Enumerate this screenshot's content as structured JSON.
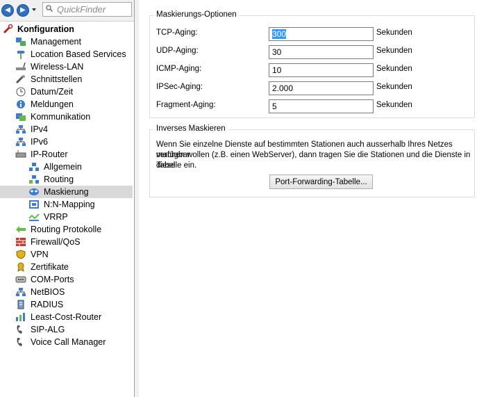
{
  "quickfinder": {
    "placeholder": "QuickFinder"
  },
  "tree": {
    "root": "Konfiguration",
    "items": [
      "Management",
      "Location Based Services",
      "Wireless-LAN",
      "Schnittstellen",
      "Datum/Zeit",
      "Meldungen",
      "Kommunikation",
      "IPv4",
      "IPv6",
      "IP-Router",
      "Routing Protokolle",
      "Firewall/QoS",
      "VPN",
      "Zertifikate",
      "COM-Ports",
      "NetBIOS",
      "RADIUS",
      "Least-Cost-Router",
      "SIP-ALG",
      "Voice Call Manager"
    ],
    "iprouter_children": [
      "Allgemein",
      "Routing",
      "Maskierung",
      "N:N-Mapping",
      "VRRP"
    ],
    "selected": "Maskierung"
  },
  "masking": {
    "title": "Maskierungs-Optionen",
    "rows": [
      {
        "label": "TCP-Aging:",
        "value": "300",
        "unit": "Sekunden"
      },
      {
        "label": "UDP-Aging:",
        "value": "30",
        "unit": "Sekunden"
      },
      {
        "label": "ICMP-Aging:",
        "value": "10",
        "unit": "Sekunden"
      },
      {
        "label": "IPSec-Aging:",
        "value": "2.000",
        "unit": "Sekunden"
      },
      {
        "label": "Fragment-Aging:",
        "value": "5",
        "unit": "Sekunden"
      }
    ]
  },
  "inverse": {
    "title": "Inverses Maskieren",
    "description_lines": [
      "Wenn Sie einzelne Dienste auf bestimmten Stationen auch ausserhalb Ihres Netzes verfügbar",
      "machen wollen (z.B. einen WebServer), dann tragen Sie die Stationen und die Dienste in diese",
      "Tabelle ein."
    ],
    "button_label": "Port-Forwarding-Tabelle..."
  }
}
